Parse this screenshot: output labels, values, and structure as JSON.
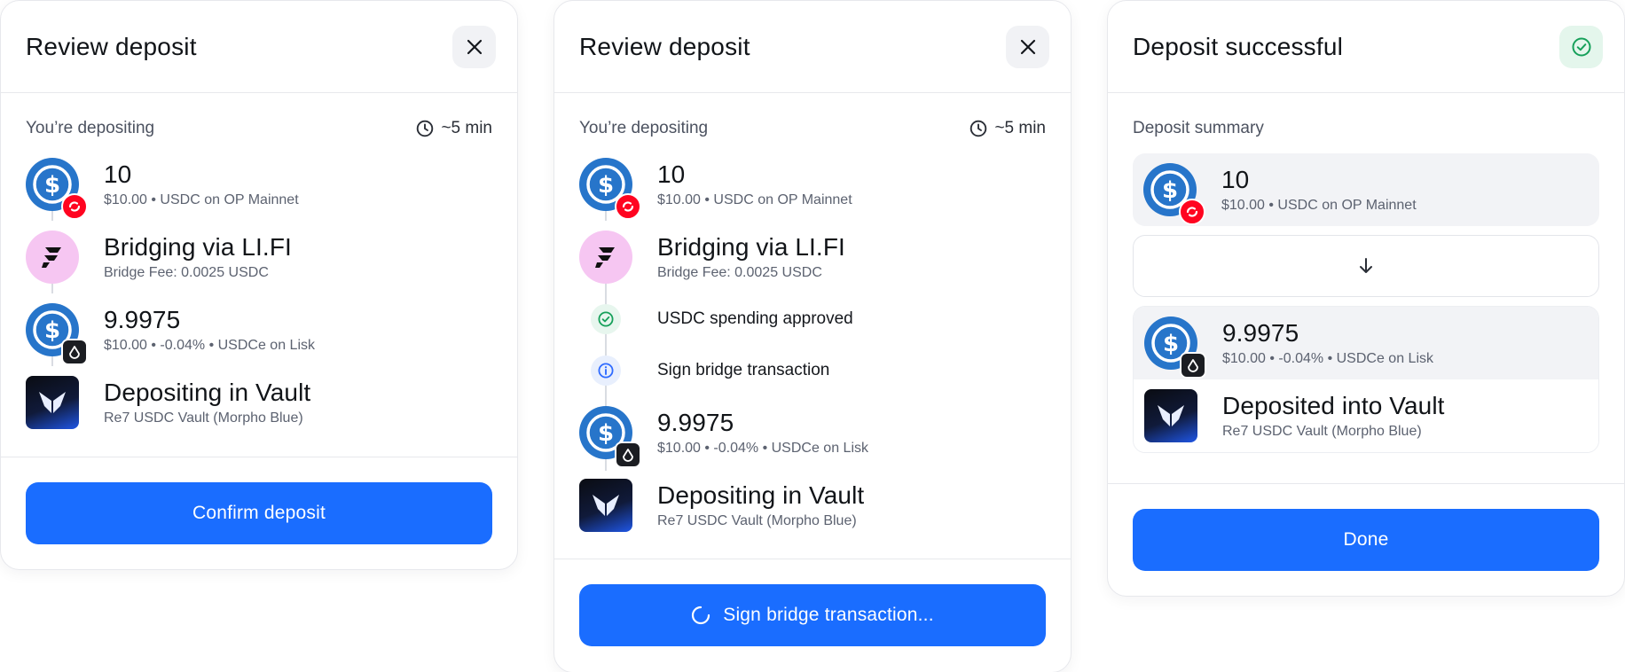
{
  "card1": {
    "title": "Review deposit",
    "subtitle": "You’re depositing",
    "eta": "~5 min",
    "steps": [
      {
        "amount": "10",
        "meta": "$10.00 • USDC on OP Mainnet"
      },
      {
        "amount": "Bridging via LI.FI",
        "meta": "Bridge Fee: 0.0025 USDC"
      },
      {
        "amount": "9.9975",
        "meta": "$10.00 • -0.04% • USDCe on Lisk"
      },
      {
        "amount": "Depositing in Vault",
        "meta": "Re7 USDC Vault (Morpho Blue)"
      }
    ],
    "button": "Confirm deposit"
  },
  "card2": {
    "title": "Review deposit",
    "subtitle": "You’re depositing",
    "eta": "~5 min",
    "steps": [
      {
        "amount": "10",
        "meta": "$10.00 • USDC on OP Mainnet"
      },
      {
        "amount": "Bridging via LI.FI",
        "meta": "Bridge Fee: 0.0025 USDC"
      },
      {
        "label": "USDC spending approved",
        "status": "complete"
      },
      {
        "label": "Sign bridge transaction",
        "status": "pending"
      },
      {
        "amount": "9.9975",
        "meta": "$10.00 • -0.04% • USDCe on Lisk"
      },
      {
        "amount": "Depositing in Vault",
        "meta": "Re7 USDC Vault (Morpho Blue)"
      }
    ],
    "button": "Sign bridge transaction..."
  },
  "card3": {
    "title": "Deposit successful",
    "subtitle": "Deposit summary",
    "from": {
      "amount": "10",
      "meta": "$10.00 • USDC on OP Mainnet"
    },
    "to": {
      "amount": "9.9975",
      "meta": "$10.00 • -0.04% • USDCe on Lisk"
    },
    "vault": {
      "amount": "Deposited into Vault",
      "meta": "Re7 USDC Vault (Morpho Blue)"
    },
    "button": "Done"
  },
  "colors": {
    "primary": "#1a6dff",
    "usdc": "#2775ca",
    "optimism": "#ff0420",
    "lifi": "#f6c6f2",
    "success": "#16a05a"
  }
}
